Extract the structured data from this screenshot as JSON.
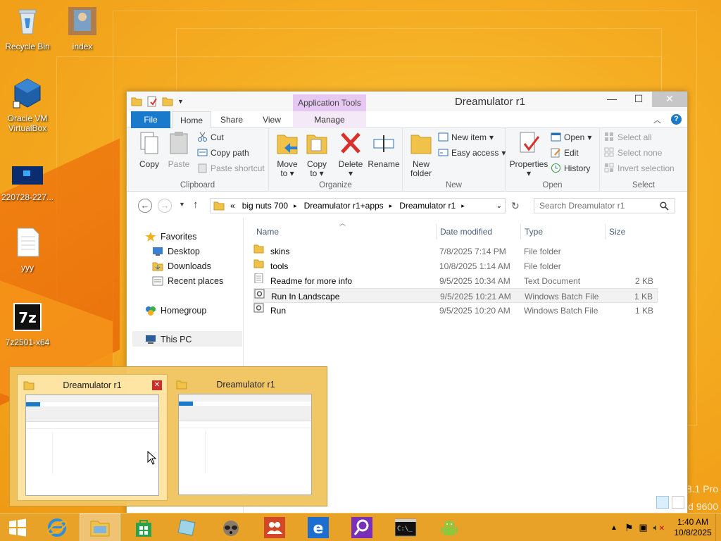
{
  "desktop": {
    "icons": [
      {
        "label": "Recycle Bin"
      },
      {
        "label": "index"
      },
      {
        "label": "Oracle VM VirtualBox"
      },
      {
        "label": "220728-227..."
      },
      {
        "label": "yyy"
      },
      {
        "label": "7z2501-x64"
      }
    ],
    "watermark_line1": "8.1 Pro",
    "watermark_line2": "d 9600"
  },
  "window": {
    "title": "Dreamulator r1",
    "context_tab_group": "Application Tools",
    "tabs": [
      "File",
      "Home",
      "Share",
      "View",
      "Manage"
    ],
    "clipboard": {
      "label": "Clipboard",
      "copy": "Copy",
      "paste": "Paste",
      "cut": "Cut",
      "copy_path": "Copy path",
      "paste_shortcut": "Paste shortcut"
    },
    "organize": {
      "label": "Organize",
      "move_to": "Move",
      "move_to2": "to",
      "copy_to": "Copy",
      "copy_to2": "to",
      "delete": "Delete",
      "rename": "Rename"
    },
    "new": {
      "label": "New",
      "new_folder": "New",
      "new_folder2": "folder",
      "new_item": "New item",
      "easy_access": "Easy access"
    },
    "open": {
      "label": "Open",
      "properties": "Properties",
      "open": "Open",
      "edit": "Edit",
      "history": "History"
    },
    "select": {
      "label": "Select",
      "select_all": "Select all",
      "select_none": "Select none",
      "invert": "Invert selection"
    },
    "address": {
      "prefix": "«",
      "segments": [
        "big nuts 700",
        "Dreamulator r1+apps",
        "Dreamulator r1"
      ]
    },
    "search_placeholder": "Search Dreamulator r1",
    "nav": {
      "favorites": "Favorites",
      "desktop": "Desktop",
      "downloads": "Downloads",
      "recent": "Recent places",
      "homegroup": "Homegroup",
      "this_pc": "This PC"
    },
    "columns": [
      "Name",
      "Date modified",
      "Type",
      "Size"
    ],
    "files": [
      {
        "name": "skins",
        "date": "7/8/2025 7:14 PM",
        "type": "File folder",
        "size": "",
        "kind": "folder"
      },
      {
        "name": "tools",
        "date": "10/8/2025 1:14 AM",
        "type": "File folder",
        "size": "",
        "kind": "folder"
      },
      {
        "name": "Readme for more info",
        "date": "9/5/2025 10:34 AM",
        "type": "Text Document",
        "size": "2 KB",
        "kind": "text"
      },
      {
        "name": "Run In Landscape",
        "date": "9/5/2025 10:21 AM",
        "type": "Windows Batch File",
        "size": "1 KB",
        "kind": "batch"
      },
      {
        "name": "Run",
        "date": "9/5/2025 10:20 AM",
        "type": "Windows Batch File",
        "size": "1 KB",
        "kind": "batch"
      }
    ]
  },
  "preview": {
    "thumbs": [
      {
        "title": "Dreamulator r1"
      },
      {
        "title": "Dreamulator r1"
      }
    ]
  },
  "taskbar": {
    "time": "1:40 AM",
    "date": "10/8/2025"
  }
}
